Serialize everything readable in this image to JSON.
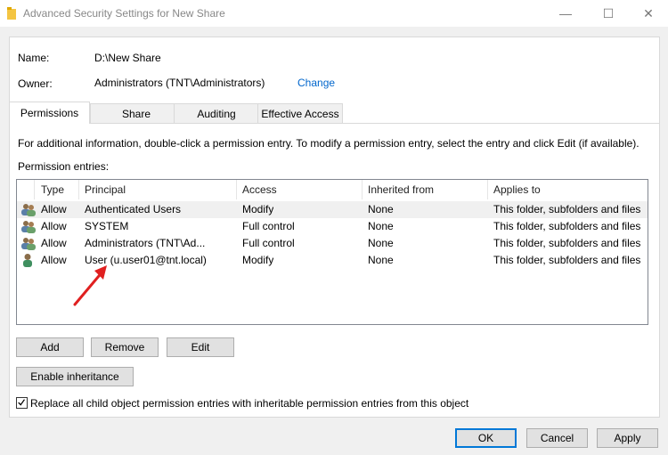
{
  "window": {
    "title": "Advanced Security Settings for New Share",
    "minimize_glyph": "—",
    "maximize_glyph": "☐",
    "close_glyph": "✕"
  },
  "info": {
    "name_label": "Name:",
    "name_value": "D:\\New Share",
    "owner_label": "Owner:",
    "owner_value": "Administrators (TNT\\Administrators)",
    "change_link": "Change"
  },
  "tabs": [
    {
      "label": "Permissions",
      "active": true
    },
    {
      "label": "Share",
      "active": false
    },
    {
      "label": "Auditing",
      "active": false
    },
    {
      "label": "Effective Access",
      "active": false
    }
  ],
  "permissions": {
    "info_text": "For additional information, double-click a permission entry. To modify a permission entry, select the entry and click Edit (if available).",
    "entries_label": "Permission entries:",
    "columns": [
      "Type",
      "Principal",
      "Access",
      "Inherited from",
      "Applies to"
    ],
    "rows": [
      {
        "icon": "group-icon",
        "type": "Allow",
        "principal": "Authenticated Users",
        "access": "Modify",
        "inherited": "None",
        "applies": "This folder, subfolders and files",
        "selected": true
      },
      {
        "icon": "group-icon",
        "type": "Allow",
        "principal": "SYSTEM",
        "access": "Full control",
        "inherited": "None",
        "applies": "This folder, subfolders and files",
        "selected": false
      },
      {
        "icon": "group-icon",
        "type": "Allow",
        "principal": "Administrators (TNT\\Ad...",
        "access": "Full control",
        "inherited": "None",
        "applies": "This folder, subfolders and files",
        "selected": false
      },
      {
        "icon": "user-icon",
        "type": "Allow",
        "principal": "User (u.user01@tnt.local)",
        "access": "Modify",
        "inherited": "None",
        "applies": "This folder, subfolders and files",
        "selected": false
      }
    ]
  },
  "buttons": {
    "add": "Add",
    "remove": "Remove",
    "edit": "Edit",
    "enable_inheritance": "Enable inheritance",
    "ok": "OK",
    "cancel": "Cancel",
    "apply": "Apply"
  },
  "replace_checkbox": {
    "label": "Replace all child object permission entries with inheritable permission entries from this object",
    "checked": true
  },
  "colors": {
    "link": "#0066cc",
    "arrow": "#e02020",
    "focus": "#0078d7"
  }
}
